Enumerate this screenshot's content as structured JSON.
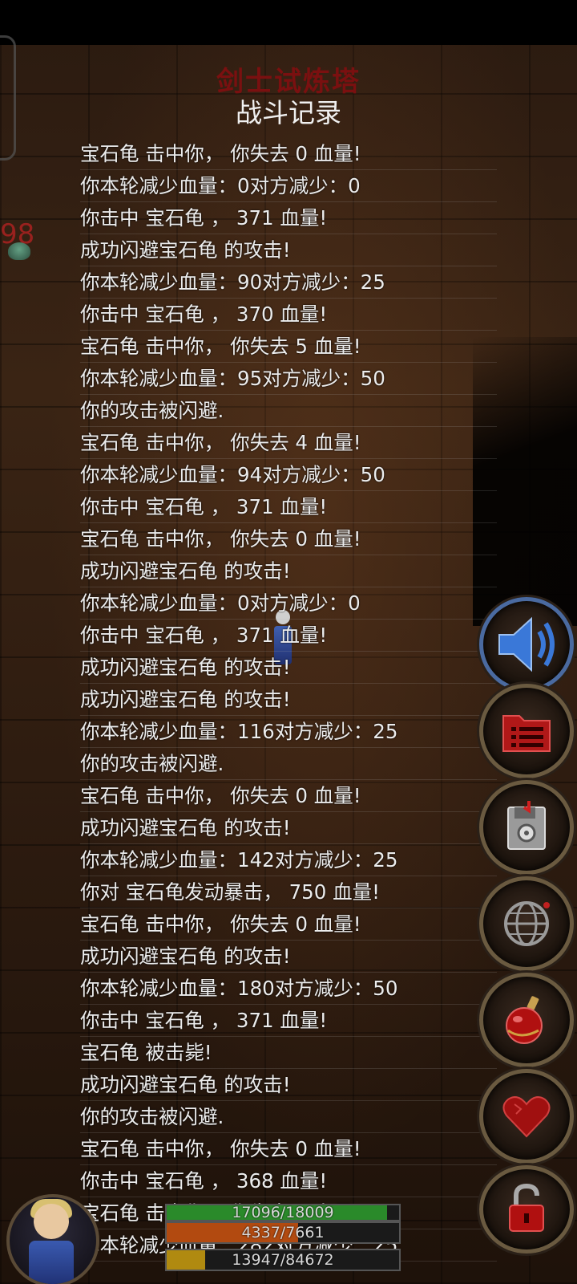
{
  "tower_title": "剑士试炼塔",
  "log_title": "战斗记录",
  "enemy_hp_fragment": "98",
  "battle_log": [
    "宝石龟 击中你， 你失去 0 血量!",
    "你本轮减少血量：0对方减少：0",
    "你击中 宝石龟 ， 371 血量!",
    "成功闪避宝石龟 的攻击!",
    "你本轮减少血量：90对方减少：25",
    "你击中 宝石龟 ， 370 血量!",
    "宝石龟 击中你， 你失去 5 血量!",
    "你本轮减少血量：95对方减少：50",
    "你的攻击被闪避.",
    "宝石龟 击中你， 你失去 4 血量!",
    "你本轮减少血量：94对方减少：50",
    "你击中 宝石龟 ， 371 血量!",
    "宝石龟 击中你， 你失去 0 血量!",
    "成功闪避宝石龟 的攻击!",
    "你本轮减少血量：0对方减少：0",
    "你击中 宝石龟 ， 371 血量!",
    "成功闪避宝石龟 的攻击!",
    "成功闪避宝石龟 的攻击!",
    "你本轮减少血量：116对方减少：25",
    "你的攻击被闪避.",
    "宝石龟 击中你， 你失去 0 血量!",
    "成功闪避宝石龟 的攻击!",
    "你本轮减少血量：142对方减少：25",
    "你对 宝石龟发动暴击， 750 血量!",
    "宝石龟 击中你， 你失去 0 血量!",
    "成功闪避宝石龟 的攻击!",
    "你本轮减少血量：180对方减少：50",
    "你击中 宝石龟 ， 371 血量!",
    "宝石龟 被击毙!",
    "成功闪避宝石龟 的攻击!",
    "你的攻击被闪避.",
    "宝石龟 击中你， 你失去 0 血量!",
    "你击中 宝石龟 ， 368 血量!",
    "宝石龟 击中你， 你失去 0 血量!",
    "你本轮减少血量：282对方减少：25"
  ],
  "side_buttons": [
    {
      "name": "sound-button",
      "icon": "speaker-icon"
    },
    {
      "name": "menu-button",
      "icon": "list-folder-icon"
    },
    {
      "name": "save-button",
      "icon": "floppy-disk-icon"
    },
    {
      "name": "world-button",
      "icon": "globe-icon"
    },
    {
      "name": "potion-button",
      "icon": "potion-icon"
    },
    {
      "name": "health-button",
      "icon": "heart-icon"
    },
    {
      "name": "lock-button",
      "icon": "unlock-icon"
    }
  ],
  "stats": {
    "hp": {
      "text": "17096/18009",
      "fraction": 0.949,
      "color": "#2a8a2a"
    },
    "mp": {
      "text": "4337/7661",
      "fraction": 0.566,
      "color": "#b24a10"
    },
    "xp": {
      "text": "13947/84672",
      "fraction": 0.165,
      "color": "#b08a10"
    }
  },
  "colors": {
    "title_red": "#7a1010",
    "log_text": "#ececec",
    "sound_ring": "#4a6aa0"
  }
}
